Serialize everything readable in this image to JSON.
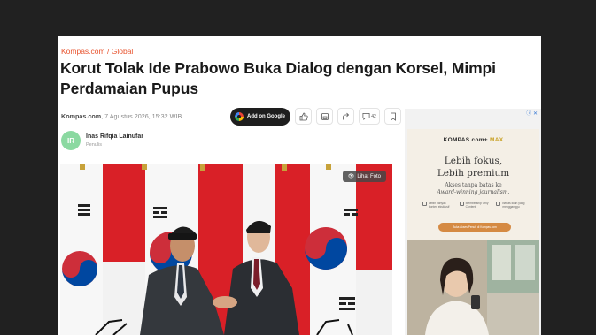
{
  "breadcrumb": {
    "site": "Kompas.com",
    "separator": "/",
    "section": "Global"
  },
  "article": {
    "title": "Korut Tolak Ide Prabowo Buka Dialog dengan Korsel, Mimpi Perdamaian Pupus",
    "source": "Kompas.com",
    "date": ", 7 Agustus 2026, 15:32 WIB"
  },
  "actions": {
    "google_label": "Add on Google",
    "comment_count": "42"
  },
  "author": {
    "initials": "IR",
    "name": "Inas Rifqia Lainufar",
    "role": "Penulis"
  },
  "photo": {
    "button_label": "Lihat Foto"
  },
  "ad": {
    "badge": "ⓘ ✕",
    "brand": "KOMPAS.com+",
    "brand_suffix": "MAX",
    "headline_1": "Lebih fokus,",
    "headline_2": "Lebih premium",
    "sub_1": "Akses tanpa batas ke",
    "sub_2": "Award-winning journalism.",
    "features": [
      "Lebih banyak konten eksklusif",
      "Membership Only Content",
      "Bebas iklan yang mengganggu"
    ],
    "cta": "Buka Akses Penuh di Kompas.com"
  },
  "colors": {
    "accent": "#e8542f",
    "background": "#212121",
    "avatar": "#8bd9a1"
  }
}
